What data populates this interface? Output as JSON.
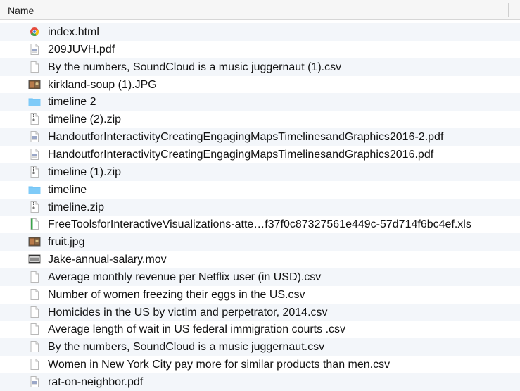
{
  "header": {
    "name_label": "Name"
  },
  "files": [
    {
      "name": "index.html",
      "icon": "chrome-html-icon"
    },
    {
      "name": "209JUVH.pdf",
      "icon": "pdf-icon"
    },
    {
      "name": "By the numbers, SoundCloud is a music juggernaut (1).csv",
      "icon": "document-icon"
    },
    {
      "name": "kirkland-soup (1).JPG",
      "icon": "image-icon"
    },
    {
      "name": "timeline 2",
      "icon": "folder-icon"
    },
    {
      "name": "timeline (2).zip",
      "icon": "zip-icon"
    },
    {
      "name": "HandoutforInteractivityCreatingEngagingMapsTimelinesandGraphics2016-2.pdf",
      "icon": "pdf-icon"
    },
    {
      "name": "HandoutforInteractivityCreatingEngagingMapsTimelinesandGraphics2016.pdf",
      "icon": "pdf-icon"
    },
    {
      "name": "timeline (1).zip",
      "icon": "zip-icon"
    },
    {
      "name": "timeline",
      "icon": "folder-icon"
    },
    {
      "name": "timeline.zip",
      "icon": "zip-icon"
    },
    {
      "name": "FreeToolsforInteractiveVisualizations-atte…f37f0c87327561e449c-57d714f6bc4ef.xls",
      "icon": "spreadsheet-icon"
    },
    {
      "name": "fruit.jpg",
      "icon": "image-icon"
    },
    {
      "name": "Jake-annual-salary.mov",
      "icon": "video-icon"
    },
    {
      "name": "Average monthly revenue per Netflix user (in USD).csv",
      "icon": "document-icon"
    },
    {
      "name": "Number of women freezing their eggs in the US.csv",
      "icon": "document-icon"
    },
    {
      "name": "Homicides in the US by victim and perpetrator, 2014.csv",
      "icon": "document-icon"
    },
    {
      "name": "Average length of wait in US federal immigration courts .csv",
      "icon": "document-icon"
    },
    {
      "name": "By the numbers, SoundCloud is a music juggernaut.csv",
      "icon": "document-icon"
    },
    {
      "name": "Women in New York City pay more for similar products than men.csv",
      "icon": "document-icon"
    },
    {
      "name": "rat-on-neighbor.pdf",
      "icon": "pdf-icon"
    }
  ],
  "colors": {
    "folder": "#6ec1f5",
    "row_alt": "#f3f6fa",
    "header_bg": "#f6f6f6"
  }
}
